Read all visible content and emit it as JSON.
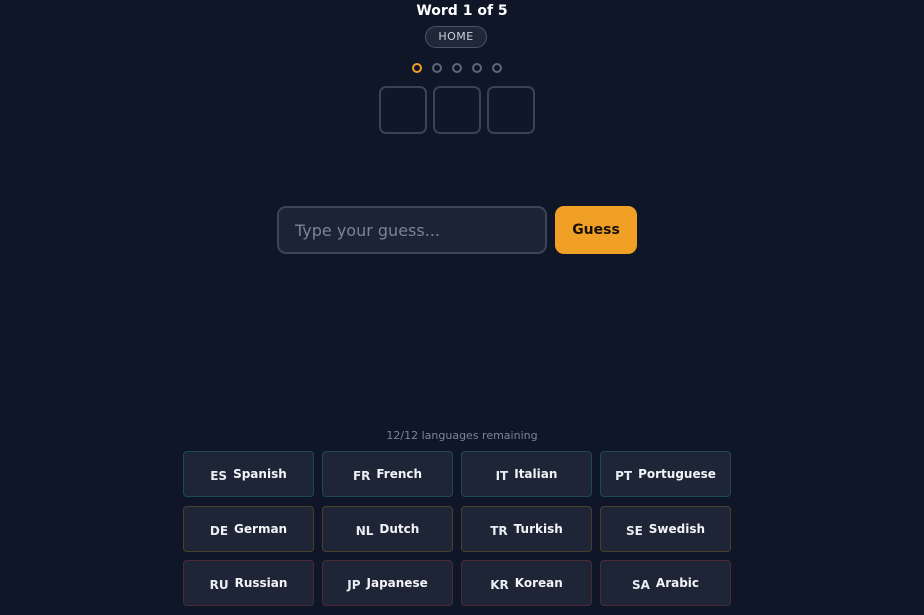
{
  "header": {
    "title": "Word 1 of 5",
    "home_label": "HOME"
  },
  "progress": {
    "total_words": 5,
    "current_index": 0,
    "active_color": "#f0a028",
    "inactive_color": "#5d6676"
  },
  "slots": {
    "count": 3,
    "letters": [
      "",
      "",
      ""
    ]
  },
  "guess": {
    "placeholder": "Type your guess...",
    "value": "",
    "button_label": "Guess",
    "button_color": "#f0a125"
  },
  "languages": {
    "remaining_text": "12/12 languages remaining",
    "items": [
      {
        "code": "ES",
        "name": "Spanish"
      },
      {
        "code": "FR",
        "name": "French"
      },
      {
        "code": "IT",
        "name": "Italian"
      },
      {
        "code": "PT",
        "name": "Portuguese"
      },
      {
        "code": "DE",
        "name": "German"
      },
      {
        "code": "NL",
        "name": "Dutch"
      },
      {
        "code": "TR",
        "name": "Turkish"
      },
      {
        "code": "SE",
        "name": "Swedish"
      },
      {
        "code": "RU",
        "name": "Russian"
      },
      {
        "code": "JP",
        "name": "Japanese"
      },
      {
        "code": "KR",
        "name": "Korean"
      },
      {
        "code": "SA",
        "name": "Arabic"
      }
    ]
  }
}
